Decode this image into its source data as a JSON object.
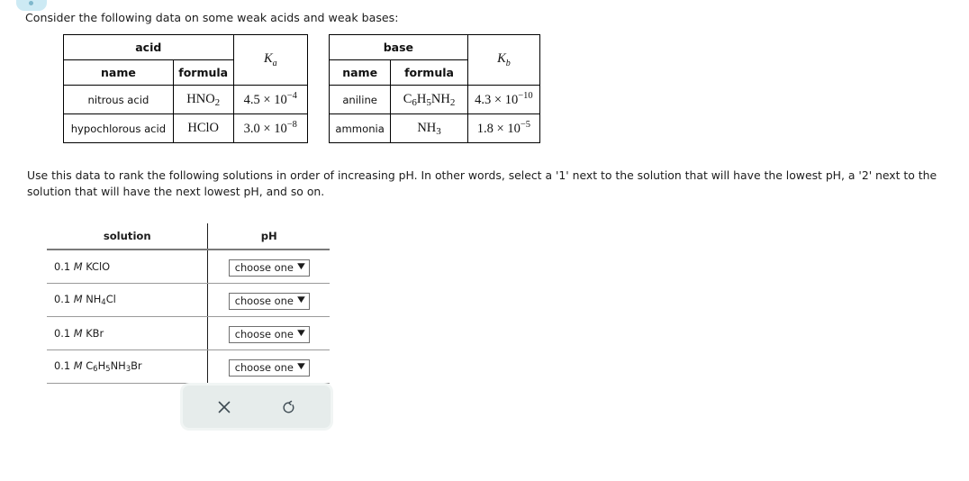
{
  "intro": "Consider the following data on some weak acids and weak bases:",
  "acid_table": {
    "group_header": "acid",
    "k_header_base": "K",
    "k_header_sub": "a",
    "columns": [
      "name",
      "formula"
    ],
    "rows": [
      {
        "name": "nitrous acid",
        "formula_main": "HNO",
        "formula_sub": "2",
        "k_mantissa": "4.5 × 10",
        "k_exponent": "−4"
      },
      {
        "name": "hypochlorous acid",
        "formula_main": "HClO",
        "formula_sub": "",
        "k_mantissa": "3.0 × 10",
        "k_exponent": "−8"
      }
    ]
  },
  "base_table": {
    "group_header": "base",
    "k_header_base": "K",
    "k_header_sub": "b",
    "columns": [
      "name",
      "formula"
    ],
    "rows": [
      {
        "name": "aniline",
        "formula_parts": [
          "C",
          "6",
          "H",
          "5",
          "NH",
          "2"
        ],
        "k_mantissa": "4.3 × 10",
        "k_exponent": "−10"
      },
      {
        "name": "ammonia",
        "formula_parts": [
          "NH",
          "3",
          "",
          "",
          "",
          ""
        ],
        "k_mantissa": "1.8 × 10",
        "k_exponent": "−5"
      }
    ]
  },
  "instructions": "Use this data to rank the following solutions in order of increasing pH. In other words, select a '1' next to the solution that will have the lowest pH, a '2' next to the solution that will have the next lowest pH, and so on.",
  "solution_table": {
    "headers": [
      "solution",
      "pH"
    ],
    "rows": [
      {
        "concentration": "0.1",
        "molarity": "M",
        "compound_html": "KClO",
        "ph_value": "choose one",
        "caret": "⌄"
      },
      {
        "concentration": "0.1",
        "molarity": "M",
        "compound_html": "NH4Cl",
        "ph_value": "choose one",
        "caret": "⌄"
      },
      {
        "concentration": "0.1",
        "molarity": "M",
        "compound_html": "KBr",
        "ph_value": "choose one",
        "caret": "⌄"
      },
      {
        "concentration": "0.1",
        "molarity": "M",
        "compound_html": "C6H5NH3Br",
        "ph_value": "choose one",
        "caret": "⌄"
      }
    ],
    "dropdown_placeholder": "choose one"
  },
  "action_panel": {
    "clear_icon": "close-x-icon",
    "undo_icon": "undo-refresh-icon",
    "background_color": "#e6eceb"
  },
  "badge": {
    "color": "#cdeaf4"
  }
}
